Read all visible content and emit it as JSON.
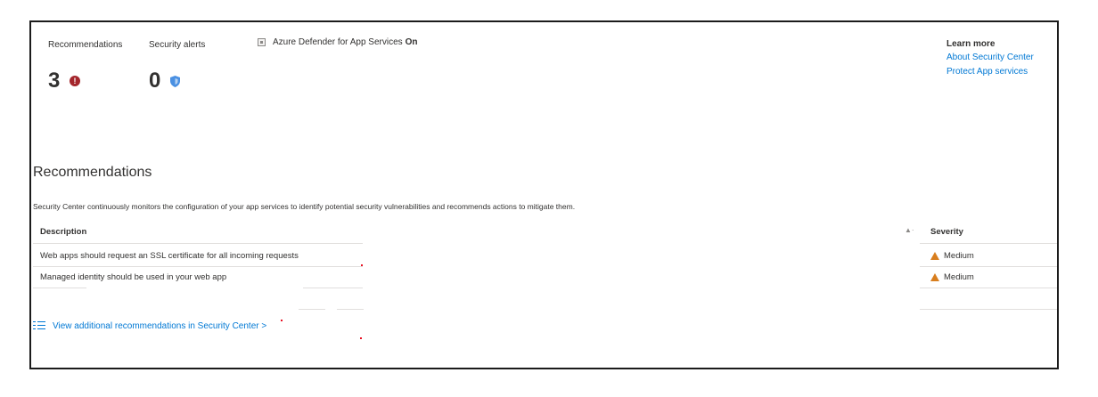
{
  "stats": {
    "recommendations_label": "Recommendations",
    "recommendations_value": "3",
    "alerts_label": "Security alerts",
    "alerts_value": "0"
  },
  "defender": {
    "label": "Azure Defender for App Services",
    "status": "On"
  },
  "learn_more": {
    "heading": "Learn more",
    "links": [
      "About Security Center",
      "Protect App services"
    ]
  },
  "section": {
    "title": "Recommendations",
    "description": "Security Center continuously monitors the configuration of your app services to identify potential security vulnerabilities and recommends actions to mitigate them."
  },
  "table": {
    "col_description": "Description",
    "col_severity": "Severity",
    "rows": [
      {
        "description": "Web apps should request an SSL certificate for all incoming requests",
        "severity": "Medium"
      },
      {
        "description": "Managed identity should be used in your web app",
        "severity": "Medium"
      }
    ]
  },
  "view_link": "View additional recommendations in Security Center >",
  "colors": {
    "accent": "#0078d4",
    "error": "#a4262c",
    "warning": "#d87e1e",
    "shield": "#4a90e2"
  },
  "icons": [
    "error-icon",
    "shield-icon",
    "app-service-icon",
    "warning-icon",
    "list-icon",
    "sort-icon"
  ]
}
